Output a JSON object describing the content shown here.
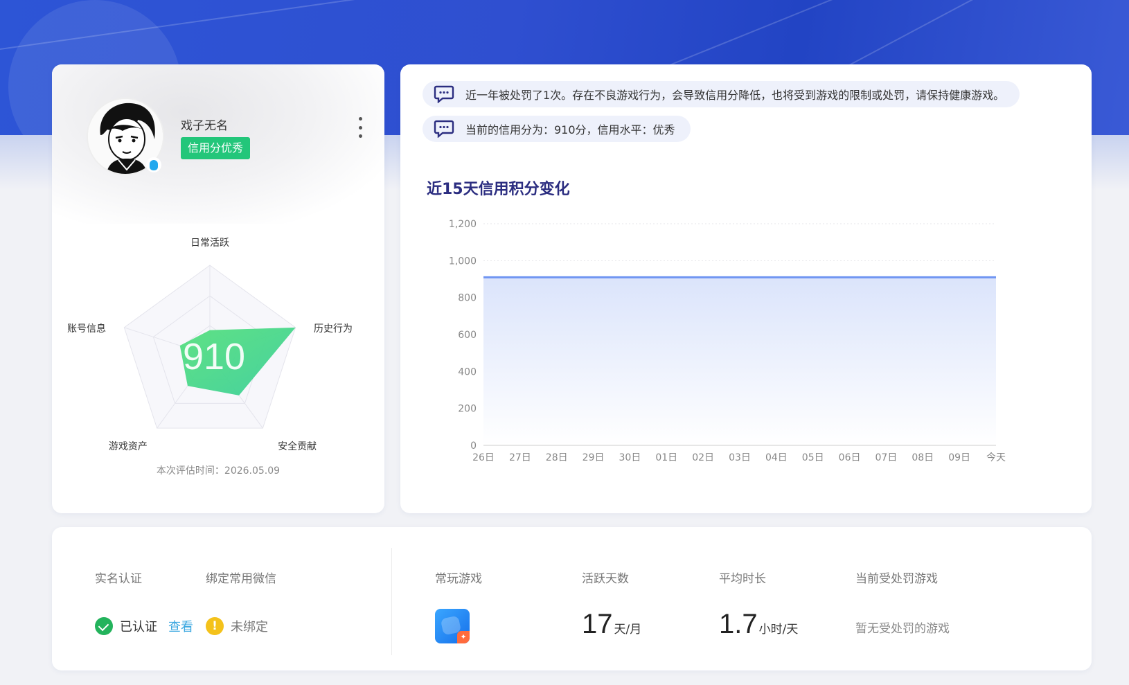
{
  "profile": {
    "username": "戏子无名",
    "credit_badge": "信用分优秀",
    "eval_time_label": "本次评估时间：",
    "eval_time": "2026.05.09",
    "score": "910",
    "radar": {
      "axes": [
        "日常活跃",
        "历史行为",
        "安全贡献",
        "游戏资产",
        "账号信息"
      ],
      "values": [
        0.28,
        1.0,
        0.55,
        0.42,
        0.35
      ]
    }
  },
  "notices": [
    "近一年被处罚了1次。存在不良游戏行为，会导致信用分降低，也将受到游戏的限制或处罚，请保持健康游戏。",
    "当前的信用分为：910分，信用水平：优秀"
  ],
  "chart_title": "近15天信用积分变化",
  "chart_data": {
    "type": "area",
    "title": "近15天信用积分变化",
    "categories": [
      "26日",
      "27日",
      "28日",
      "29日",
      "30日",
      "01日",
      "02日",
      "03日",
      "04日",
      "05日",
      "06日",
      "07日",
      "08日",
      "09日",
      "今天"
    ],
    "values": [
      910,
      910,
      910,
      910,
      910,
      910,
      910,
      910,
      910,
      910,
      910,
      910,
      910,
      910,
      910
    ],
    "ylim": [
      0,
      1200
    ],
    "yticks": [
      "0",
      "200",
      "400",
      "600",
      "800",
      "1,000",
      "1,200"
    ],
    "grid": true,
    "line_color": "#6f95f2"
  },
  "stats": {
    "real_name_label": "实名认证",
    "real_name_status": "已认证",
    "real_name_link": "查看",
    "wechat_label": "绑定常用微信",
    "wechat_status": "未绑定",
    "frequent_game_label": "常玩游戏",
    "active_days_label": "活跃天数",
    "active_days_value": "17",
    "active_days_unit": "天/月",
    "avg_duration_label": "平均时长",
    "avg_duration_value": "1.7",
    "avg_duration_unit": "小时/天",
    "punished_label": "当前受处罚游戏",
    "punished_value": "暂无受处罚的游戏"
  }
}
